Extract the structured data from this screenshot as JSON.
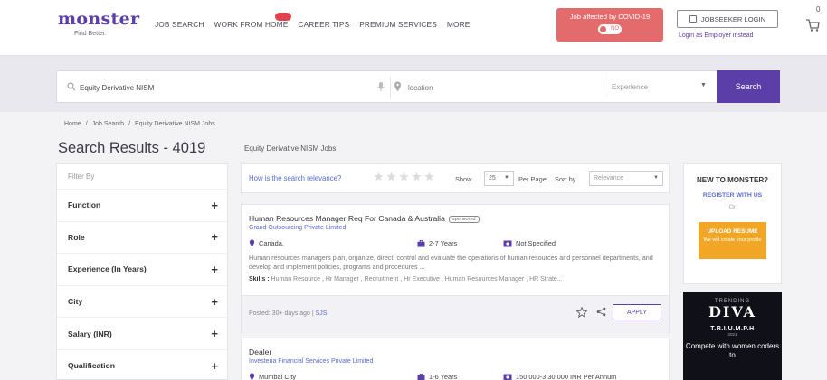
{
  "header": {
    "logo": "monster",
    "logo_tag": "Find Better.",
    "nav": [
      "JOB SEARCH",
      "WORK FROM HOME",
      "CAREER TIPS",
      "PREMIUM SERVICES",
      "MORE"
    ],
    "covid_text": "Job affected by COVID-19",
    "covid_toggle": "NO",
    "login": "JOBSEEKER LOGIN",
    "employer_link": "Login as Employer instead",
    "cart_count": "0"
  },
  "search": {
    "query": "Equity Derivative NISM",
    "location_placeholder": "location",
    "experience_placeholder": "Experience",
    "button": "Search"
  },
  "breadcrumb": [
    "Home",
    "Job Search",
    "Equity Derivative NISM Jobs"
  ],
  "results": {
    "title": "Search Results - 4019",
    "caption": "Equity Derivative NISM Jobs"
  },
  "filters": {
    "title": "Filter By",
    "items": [
      "Function",
      "Role",
      "Experience (In Years)",
      "City",
      "Salary (INR)",
      "Qualification"
    ]
  },
  "toolbar": {
    "relevance_question": "How is the search relevance?",
    "show_label": "Show",
    "show_value": "25",
    "per_page_label": "Per Page",
    "sort_label": "Sort by",
    "sort_value": "Relevance"
  },
  "jobs": [
    {
      "title": "Human Resources Manager Req For Canada & Australia",
      "badge": "sponsored",
      "company": "Grand Outsourcing Private Limited",
      "location": "Canada,",
      "experience": "2-7 Years",
      "salary": "Not Specified",
      "description": "Human resources managers plan, organize, direct, control and evaluate the operations of human resources and personnel departments, and develop and implement policies, programs and procedures ...",
      "skills_label": "Skills :",
      "skills": "Human Resource , Hr Manager , Recruitment , Hr Executive , Human Resources Manager , HR Strate...",
      "posted": "Posted: 30+ days ago |",
      "posted_tag": "SJS",
      "apply": "APPLY"
    },
    {
      "title": "Dealer",
      "company": "Investeria Financial Services Private Limited",
      "location": "Mumbai City",
      "experience": "1-6 Years",
      "salary": "150,000-3,30,000 INR Per Annum"
    }
  ],
  "promo": {
    "title": "NEW TO MONSTER?",
    "register": "REGISTER WITH US",
    "or": "Or",
    "upload_title": "UPLOAD RESUME",
    "upload_sub": "We will create your profile"
  },
  "ad": {
    "top": "TRENDING",
    "brand": "DIVA",
    "triumph": "T.R.I.U.M.P.H",
    "year": "2021",
    "line": "Compete with women coders to"
  },
  "colors": {
    "brand": "#5b3ea8",
    "covid": "#e46b6b",
    "link": "#5b6bcf",
    "upload": "#f1a625"
  }
}
